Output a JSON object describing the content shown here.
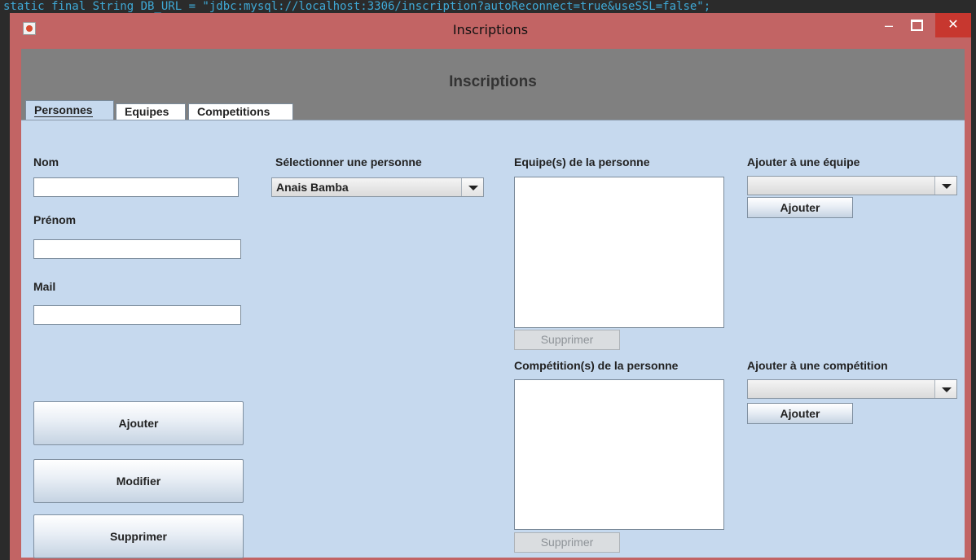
{
  "background_code": "static final String DB_URL = \"jdbc:mysql://localhost:3306/inscription?autoReconnect=true&useSSL=false\";",
  "window": {
    "title": "Inscriptions",
    "controls": {
      "minimize": "–",
      "maximize": "",
      "close": "✕"
    }
  },
  "header": {
    "title": "Inscriptions"
  },
  "tabs": [
    {
      "label": "Personnes",
      "active": true
    },
    {
      "label": "Equipes",
      "active": false
    },
    {
      "label": "Competitions",
      "active": false
    }
  ],
  "form": {
    "nom_label": "Nom",
    "nom_value": "",
    "prenom_label": "Prénom",
    "prenom_value": "",
    "mail_label": "Mail",
    "mail_value": ""
  },
  "person_select": {
    "label": "Sélectionner une personne",
    "selected": "Anais Bamba"
  },
  "teams": {
    "label": "Equipe(s) de la personne",
    "items": [],
    "remove_button": "Supprimer",
    "add_label": "Ajouter à une équipe",
    "add_selected": "",
    "add_button": "Ajouter"
  },
  "competitions": {
    "label": "Compétition(s) de la personne",
    "items": [],
    "remove_button": "Supprimer",
    "add_label": "Ajouter à une compétition",
    "add_selected": "",
    "add_button": "Ajouter"
  },
  "actions": {
    "add": "Ajouter",
    "modify": "Modifier",
    "delete": "Supprimer"
  },
  "colors": {
    "window_border": "#c26464",
    "header_band": "#808080",
    "panel_background": "#c6d9ee",
    "close_button": "#c7372f"
  }
}
